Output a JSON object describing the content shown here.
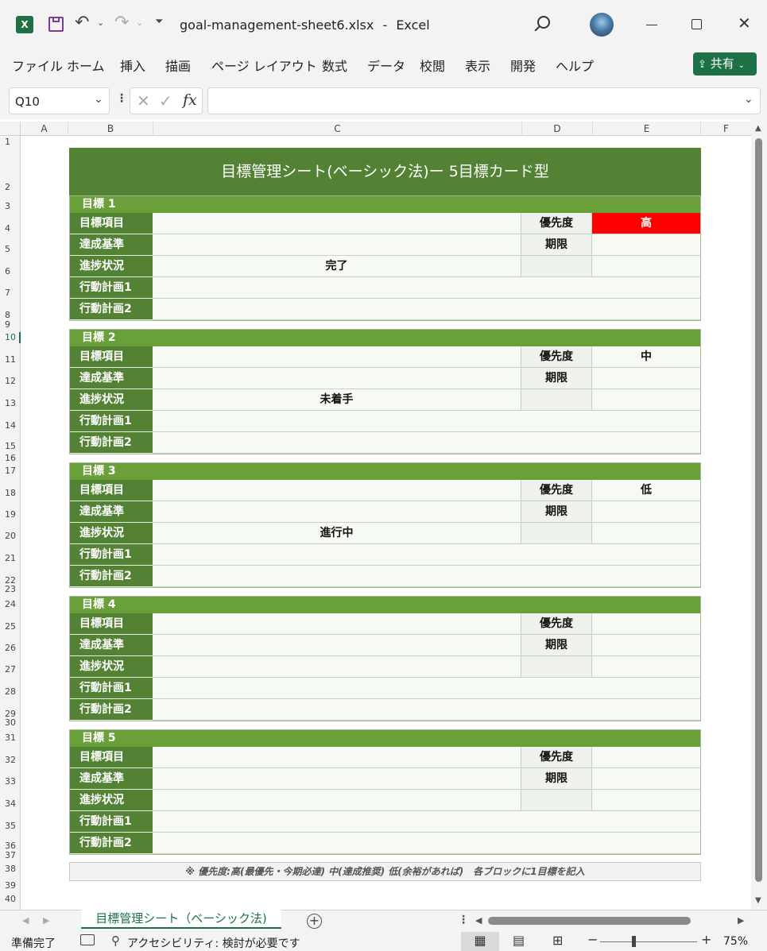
{
  "window": {
    "filename": "goal-management-sheet6.xlsx",
    "separator": "-",
    "app": "Excel"
  },
  "menu": [
    "ファイル",
    "ホーム",
    "挿入",
    "描画",
    "ページ レイアウト",
    "数式",
    "データ",
    "校閲",
    "表示",
    "開発",
    "ヘルプ"
  ],
  "share_label": "共有",
  "namebox": "Q10",
  "formula": "",
  "columns": [
    "A",
    "B",
    "C",
    "D",
    "E",
    "F"
  ],
  "rows": [
    "1",
    "2",
    "3",
    "4",
    "5",
    "6",
    "7",
    "8",
    "9",
    "10",
    "11",
    "12",
    "13",
    "14",
    "15",
    "16",
    "17",
    "18",
    "19",
    "20",
    "21",
    "22",
    "23",
    "24",
    "25",
    "26",
    "27",
    "28",
    "29",
    "30",
    "31",
    "32",
    "33",
    "34",
    "35",
    "36",
    "37",
    "38",
    "39",
    "40"
  ],
  "sheet": {
    "title": "目標管理シート(ベーシック法)ー 5目標カード型",
    "labels": {
      "item": "目標項目",
      "criteria": "達成基準",
      "progress": "進捗状況",
      "plan1": "行動計画1",
      "plan2": "行動計画2",
      "priority": "優先度",
      "deadline": "期限"
    },
    "blocks": [
      {
        "head": "目標 1",
        "progress": "完了",
        "priority": "高",
        "priority_color": "#ff0000"
      },
      {
        "head": "目標 2",
        "progress": "未着手",
        "priority": "中",
        "priority_color": ""
      },
      {
        "head": "目標 3",
        "progress": "進行中",
        "priority": "低",
        "priority_color": ""
      },
      {
        "head": "目標 4",
        "progress": "",
        "priority": "",
        "priority_color": ""
      },
      {
        "head": "目標 5",
        "progress": "",
        "priority": "",
        "priority_color": ""
      }
    ],
    "note": "※ 優先度:高(最優先・今期必達) 中(達成推奨) 低(余裕があれば)　各ブロックに1目標を記入"
  },
  "sheet_tab": "目標管理シート（ベーシック法)",
  "status": {
    "ready": "準備完了",
    "accessibility": "アクセシビリティ: 検討が必要です",
    "zoom": "75%"
  },
  "colors": {
    "accent": "#548235",
    "header_green": "#6aa03a",
    "excel_green": "#1e7145"
  }
}
